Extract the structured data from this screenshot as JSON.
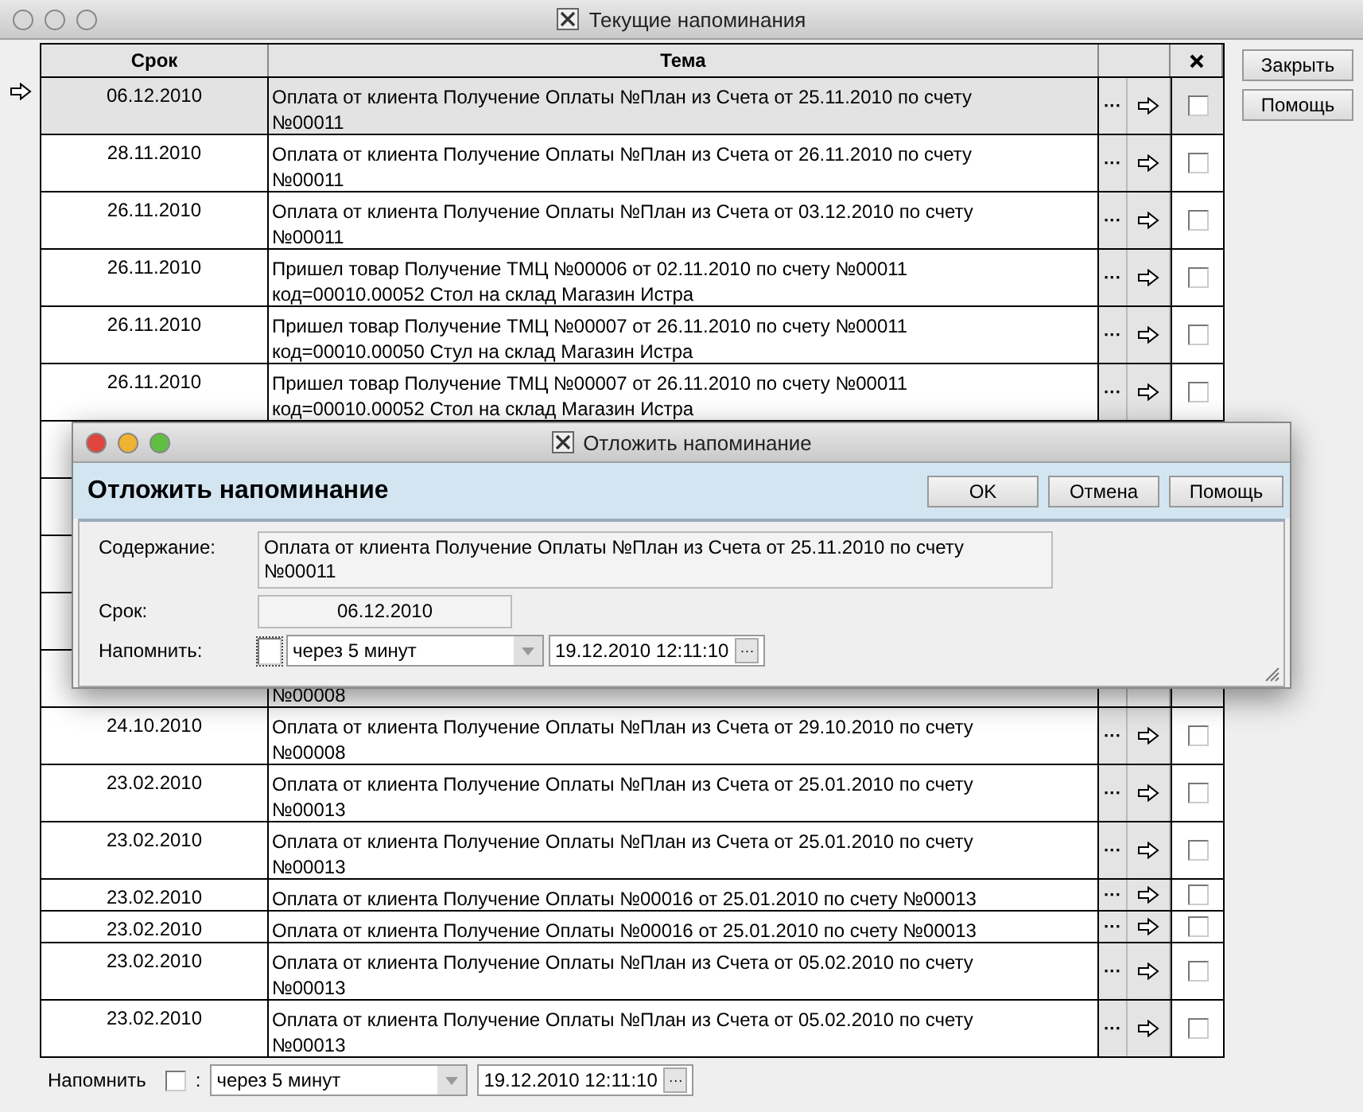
{
  "window": {
    "title": "Текущие напоминания"
  },
  "table": {
    "columns": [
      "Срок",
      "Тема"
    ],
    "details_label": "···",
    "rows": [
      {
        "kind": "item",
        "selected": true,
        "date": "06.12.2010",
        "theme": [
          "Оплата от клиента Получение Оплаты №План из Счета от 25.11.2010 по счету",
          "№00011"
        ],
        "done": false
      },
      {
        "kind": "item",
        "selected": false,
        "date": "28.11.2010",
        "theme": [
          "Оплата от клиента Получение Оплаты №План из Счета от 26.11.2010 по счету",
          "№00011"
        ],
        "done": false
      },
      {
        "kind": "item",
        "selected": false,
        "date": "26.11.2010",
        "theme": [
          "Оплата от клиента Получение Оплаты №План из Счета от 03.12.2010 по счету",
          "№00011"
        ],
        "done": false
      },
      {
        "kind": "item",
        "selected": false,
        "date": "26.11.2010",
        "theme": [
          "Пришел товар Получение ТМЦ №00006 от 02.11.2010 по счету №00011",
          "код=00010.00052 Стол на склад Магазин Истра"
        ],
        "done": false
      },
      {
        "kind": "item",
        "selected": false,
        "date": "26.11.2010",
        "theme": [
          "Пришел товар Получение ТМЦ №00007 от 26.11.2010 по счету №00011",
          "код=00010.00050 Стул на склад Магазин Истра"
        ],
        "done": false
      },
      {
        "kind": "item",
        "selected": false,
        "date": "26.11.2010",
        "theme": [
          "Пришел товар Получение ТМЦ №00007 от 26.11.2010 по счету №00011",
          "код=00010.00052 Стол на склад Магазин Истра"
        ],
        "done": false
      },
      {
        "kind": "covered"
      },
      {
        "kind": "covered"
      },
      {
        "kind": "covered"
      },
      {
        "kind": "covered"
      },
      {
        "kind": "covered",
        "theme_tail": "№00008"
      },
      {
        "kind": "item",
        "selected": false,
        "date": "24.10.2010",
        "theme": [
          "Оплата от клиента Получение Оплаты №План из Счета от 29.10.2010 по счету",
          "№00008"
        ],
        "done": false
      },
      {
        "kind": "item",
        "selected": false,
        "date": "23.02.2010",
        "theme": [
          "Оплата от клиента Получение Оплаты №План из Счета от 25.01.2010 по счету",
          "№00013"
        ],
        "done": false
      },
      {
        "kind": "item",
        "selected": false,
        "date": "23.02.2010",
        "theme": [
          "Оплата от клиента Получение Оплаты №План из Счета от 25.01.2010 по счету",
          "№00013"
        ],
        "done": false
      },
      {
        "kind": "item",
        "selected": false,
        "date": "23.02.2010",
        "theme": [
          "Оплата от клиента Получение Оплаты №00016 от 25.01.2010 по счету №00013"
        ],
        "done": false
      },
      {
        "kind": "item",
        "selected": false,
        "date": "23.02.2010",
        "theme": [
          "Оплата от клиента Получение Оплаты №00016 от 25.01.2010 по счету №00013"
        ],
        "done": false
      },
      {
        "kind": "item",
        "selected": false,
        "date": "23.02.2010",
        "theme": [
          "Оплата от клиента Получение Оплаты №План из Счета от 05.02.2010 по счету",
          "№00013"
        ],
        "done": false
      },
      {
        "kind": "item",
        "selected": false,
        "date": "23.02.2010",
        "theme": [
          "Оплата от клиента Получение Оплаты №План из Счета от 05.02.2010 по счету",
          "№00013"
        ],
        "done": false
      }
    ]
  },
  "side_buttons": [
    "Закрыть",
    "Помощь"
  ],
  "bottom": {
    "label": "Напомнить",
    "checked": false,
    "separator": ":",
    "interval": "через 5 минут",
    "datetime": "19.12.2010 12:11:10",
    "more": "···"
  },
  "dialog": {
    "title": "Отложить напоминание",
    "heading": "Отложить напоминание",
    "buttons": [
      "OK",
      "Отмена",
      "Помощь"
    ],
    "content_label": "Содержание:",
    "content": [
      "Оплата от клиента Получение Оплаты №План из Счета от 25.11.2010 по счету",
      "№00011"
    ],
    "date_label": "Срок:",
    "date": "06.12.2010",
    "remind_label": "Напомнить:",
    "remind_checked": false,
    "interval": "через 5 минут",
    "datetime": "19.12.2010 12:11:10",
    "more": "···"
  }
}
